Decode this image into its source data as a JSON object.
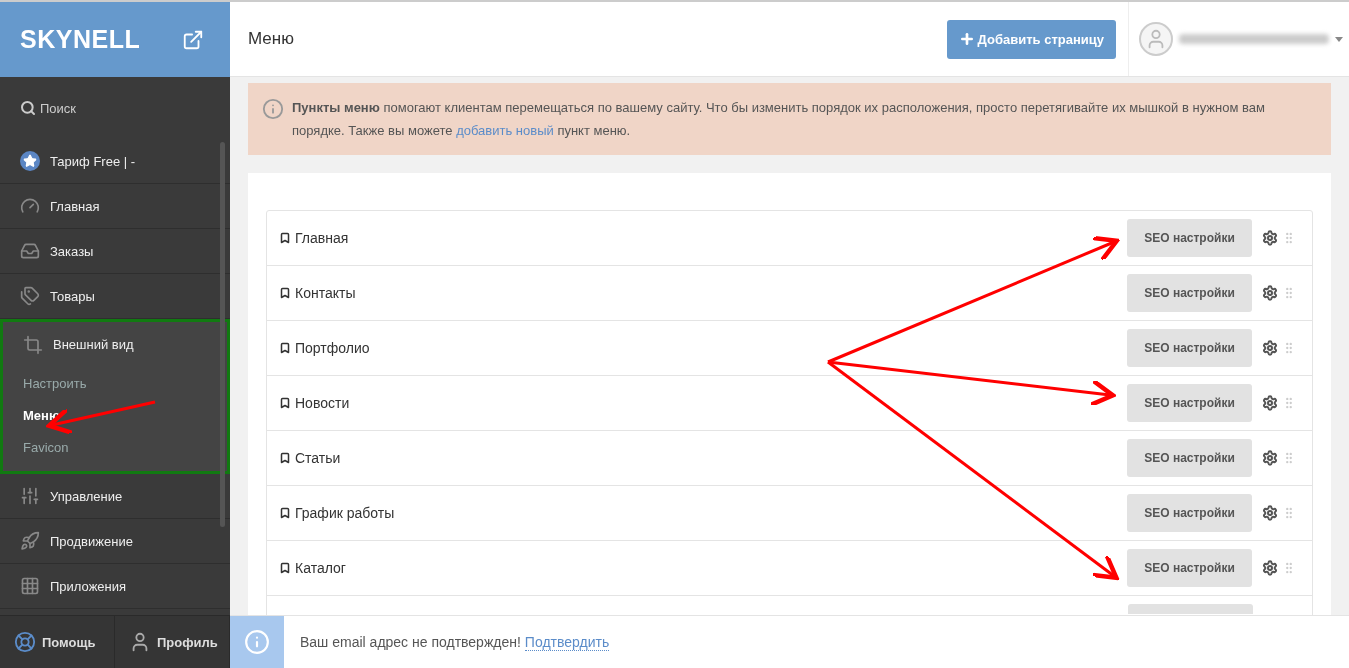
{
  "logo": {
    "text": "SKYNELL"
  },
  "header": {
    "title": "Меню",
    "add_button": "Добавить страницу"
  },
  "search": {
    "label": "Поиск"
  },
  "nav": [
    {
      "kind": "plan",
      "label": "Тариф Free | -",
      "expanded": false,
      "highlighted": false
    },
    {
      "kind": "dashboard",
      "label": "Главная",
      "expanded": false,
      "highlighted": false
    },
    {
      "kind": "orders",
      "label": "Заказы",
      "expanded": false,
      "highlighted": false
    },
    {
      "kind": "products",
      "label": "Товары",
      "expanded": false,
      "highlighted": false
    },
    {
      "kind": "design",
      "label": "Внешний вид",
      "expanded": true,
      "highlighted": true,
      "children": [
        {
          "label": "Настроить",
          "selected": false
        },
        {
          "label": "Меню",
          "selected": true
        },
        {
          "label": "Favicon",
          "selected": false
        }
      ]
    },
    {
      "kind": "settings",
      "label": "Управление",
      "expanded": false,
      "highlighted": false
    },
    {
      "kind": "promo",
      "label": "Продвижение",
      "expanded": false,
      "highlighted": false
    },
    {
      "kind": "apps",
      "label": "Приложения",
      "expanded": false,
      "highlighted": false
    }
  ],
  "footer_nav": [
    {
      "kind": "help",
      "label": "Помощь"
    },
    {
      "kind": "profile",
      "label": "Профиль"
    }
  ],
  "alert": {
    "text": "**Пункты меню** помогают клиентам перемещаться по вашему сайту. Что бы изменить порядок их расположения, просто перетягивайте их мышкой в нужном вам порядке. Также вы можете",
    "link": "добавить новый",
    "after": "пункт меню."
  },
  "menu_items": [
    {
      "label": "Главная",
      "button": "SEO настройки"
    },
    {
      "label": "Контакты",
      "button": "SEO настройки"
    },
    {
      "label": "Портфолио",
      "button": "SEO настройки"
    },
    {
      "label": "Новости",
      "button": "SEO настройки"
    },
    {
      "label": "Статьи",
      "button": "SEO настройки"
    },
    {
      "label": "График работы",
      "button": "SEO настройки"
    },
    {
      "label": "Каталог",
      "button": "SEO настройки"
    }
  ],
  "notice": {
    "text": "Ваш email адрес не подтвержден!",
    "link": "Подтвердить"
  }
}
